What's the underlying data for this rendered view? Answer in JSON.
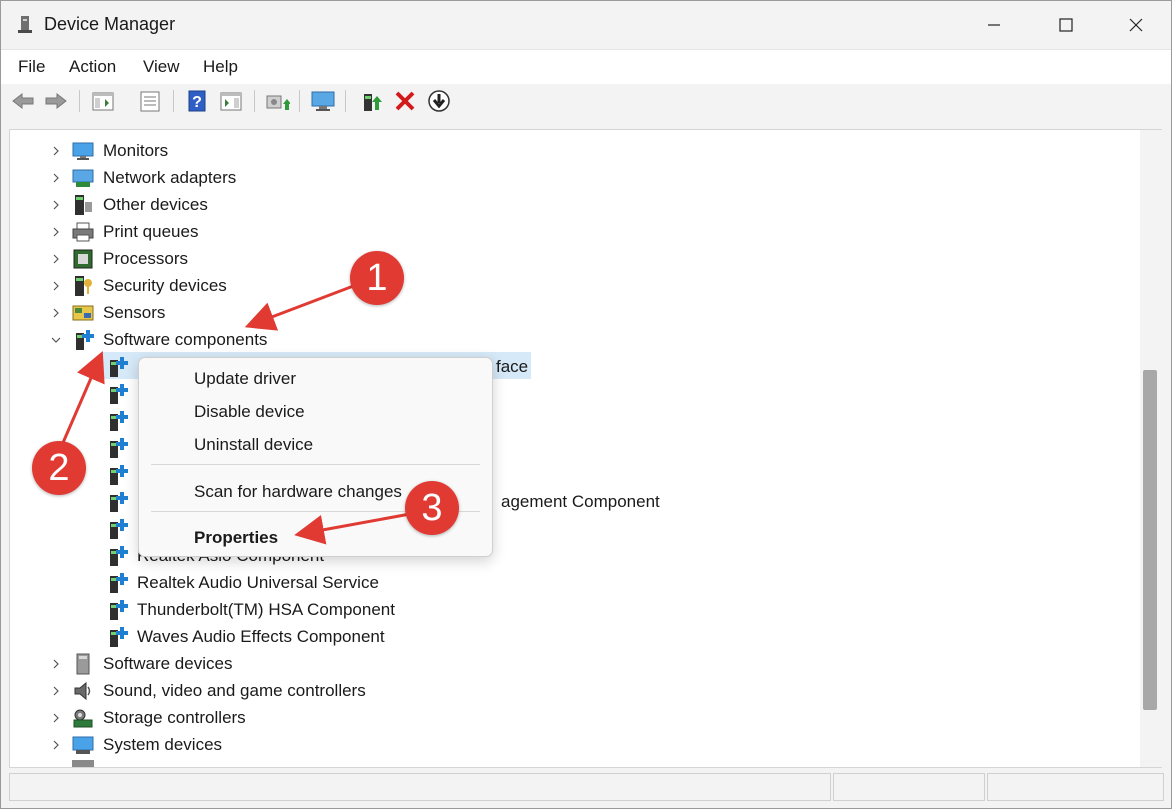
{
  "window": {
    "title": "Device Manager"
  },
  "menu": [
    "File",
    "Action",
    "View",
    "Help"
  ],
  "toolbar": {
    "buttons": [
      "back-arrow-icon",
      "forward-arrow-icon",
      "show-hide-console-tree-icon",
      "properties-sheet-icon",
      "help-icon",
      "action-pane-icon",
      "update-driver-icon",
      "scan-hardware-icon",
      "enable-device-icon",
      "uninstall-device-icon",
      "disable-device-icon"
    ]
  },
  "tree": {
    "categories_top": [
      {
        "label": "Monitors",
        "icon": "monitor-icon"
      },
      {
        "label": "Network adapters",
        "icon": "network-adapter-icon"
      },
      {
        "label": "Other devices",
        "icon": "other-device-icon"
      },
      {
        "label": "Print queues",
        "icon": "printer-icon"
      },
      {
        "label": "Processors",
        "icon": "processor-icon"
      },
      {
        "label": "Security devices",
        "icon": "security-device-icon"
      },
      {
        "label": "Sensors",
        "icon": "sensor-icon"
      }
    ],
    "expanded": {
      "label": "Software components",
      "icon": "software-component-icon"
    },
    "children": [
      {
        "label": "Realtek Asio Component"
      },
      {
        "label": "Realtek Audio Universal Service"
      },
      {
        "label": "Thunderbolt(TM) HSA Component"
      },
      {
        "label": "Waves Audio Effects Component"
      }
    ],
    "partial": {
      "selected_suffix": "face",
      "row6_suffix": "agement Component"
    },
    "categories_bottom": [
      {
        "label": "Software devices",
        "icon": "software-device-icon"
      },
      {
        "label": "Sound, video and game controllers",
        "icon": "speaker-icon"
      },
      {
        "label": "Storage controllers",
        "icon": "storage-controller-icon"
      },
      {
        "label": "System devices",
        "icon": "system-device-icon"
      }
    ]
  },
  "context_menu": {
    "items": [
      "Update driver",
      "Disable device",
      "Uninstall device",
      "Scan for hardware changes"
    ],
    "properties": "Properties"
  },
  "annotations": [
    "1",
    "2",
    "3"
  ],
  "colors": {
    "accent_red": "#e03a33",
    "selection": "#d6e9f8"
  }
}
